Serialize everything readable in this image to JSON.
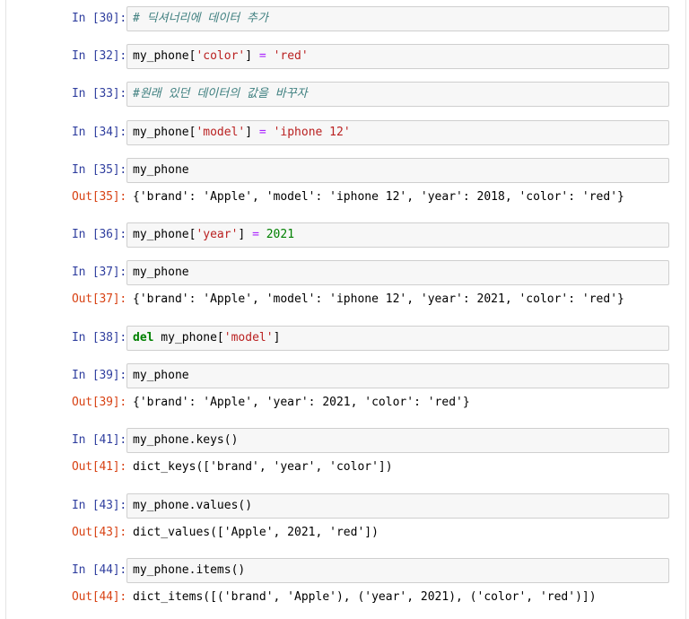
{
  "cells": [
    {
      "prompt": "In [30]:",
      "code": [
        {
          "text": "# 딕셔너리에 데이터 추가",
          "cls": "tok-comment"
        }
      ],
      "output": null
    },
    {
      "prompt": "In [32]:",
      "code": [
        {
          "text": "my_phone[",
          "cls": ""
        },
        {
          "text": "'color'",
          "cls": "tok-str"
        },
        {
          "text": "] ",
          "cls": ""
        },
        {
          "text": "=",
          "cls": "tok-op"
        },
        {
          "text": " ",
          "cls": ""
        },
        {
          "text": "'red'",
          "cls": "tok-str"
        }
      ],
      "output": null
    },
    {
      "prompt": "In [33]:",
      "code": [
        {
          "text": "#원래 있던 데이터의 값을 바꾸자",
          "cls": "tok-comment"
        }
      ],
      "output": null
    },
    {
      "prompt": "In [34]:",
      "code": [
        {
          "text": "my_phone[",
          "cls": ""
        },
        {
          "text": "'model'",
          "cls": "tok-str"
        },
        {
          "text": "] ",
          "cls": ""
        },
        {
          "text": "=",
          "cls": "tok-op"
        },
        {
          "text": " ",
          "cls": ""
        },
        {
          "text": "'iphone 12'",
          "cls": "tok-str"
        }
      ],
      "output": null
    },
    {
      "prompt": "In [35]:",
      "code": [
        {
          "text": "my_phone",
          "cls": ""
        }
      ],
      "output": {
        "prompt": "Out[35]:",
        "text": "{'brand': 'Apple', 'model': 'iphone 12', 'year': 2018, 'color': 'red'}"
      }
    },
    {
      "prompt": "In [36]:",
      "code": [
        {
          "text": "my_phone[",
          "cls": ""
        },
        {
          "text": "'year'",
          "cls": "tok-str"
        },
        {
          "text": "] ",
          "cls": ""
        },
        {
          "text": "=",
          "cls": "tok-op"
        },
        {
          "text": " ",
          "cls": ""
        },
        {
          "text": "2021",
          "cls": "tok-num"
        }
      ],
      "output": null
    },
    {
      "prompt": "In [37]:",
      "code": [
        {
          "text": "my_phone",
          "cls": ""
        }
      ],
      "output": {
        "prompt": "Out[37]:",
        "text": "{'brand': 'Apple', 'model': 'iphone 12', 'year': 2021, 'color': 'red'}"
      }
    },
    {
      "prompt": "In [38]:",
      "code": [
        {
          "text": "del",
          "cls": "tok-kw"
        },
        {
          "text": " my_phone[",
          "cls": ""
        },
        {
          "text": "'model'",
          "cls": "tok-str"
        },
        {
          "text": "]",
          "cls": ""
        }
      ],
      "output": null
    },
    {
      "prompt": "In [39]:",
      "code": [
        {
          "text": "my_phone",
          "cls": ""
        }
      ],
      "output": {
        "prompt": "Out[39]:",
        "text": "{'brand': 'Apple', 'year': 2021, 'color': 'red'}"
      }
    },
    {
      "prompt": "In [41]:",
      "code": [
        {
          "text": "my_phone.keys()",
          "cls": ""
        }
      ],
      "output": {
        "prompt": "Out[41]:",
        "text": "dict_keys(['brand', 'year', 'color'])"
      }
    },
    {
      "prompt": "In [43]:",
      "code": [
        {
          "text": "my_phone.values()",
          "cls": ""
        }
      ],
      "output": {
        "prompt": "Out[43]:",
        "text": "dict_values(['Apple', 2021, 'red'])"
      }
    },
    {
      "prompt": "In [44]:",
      "code": [
        {
          "text": "my_phone.items()",
          "cls": ""
        }
      ],
      "output": {
        "prompt": "Out[44]:",
        "text": "dict_items([('brand', 'Apple'), ('year', 2021), ('color', 'red')])"
      }
    }
  ]
}
